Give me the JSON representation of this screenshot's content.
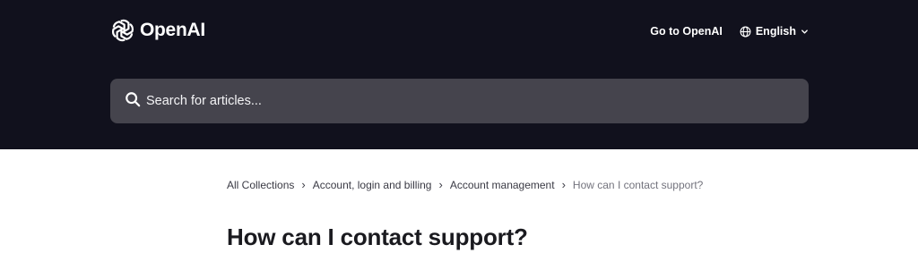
{
  "header": {
    "logo_text": "OpenAI",
    "logo_icon": "openai-logo-icon",
    "background": "#11111d",
    "nav_link": "Go to OpenAI",
    "language": "English",
    "language_icon": "globe-icon"
  },
  "search": {
    "placeholder": "Search for articles...",
    "value": "",
    "icon": "search-icon"
  },
  "breadcrumb": {
    "items": [
      "All Collections",
      "Account, login and billing",
      "Account management"
    ],
    "current": "How can I contact support?"
  },
  "article": {
    "title": "How can I contact support?"
  }
}
